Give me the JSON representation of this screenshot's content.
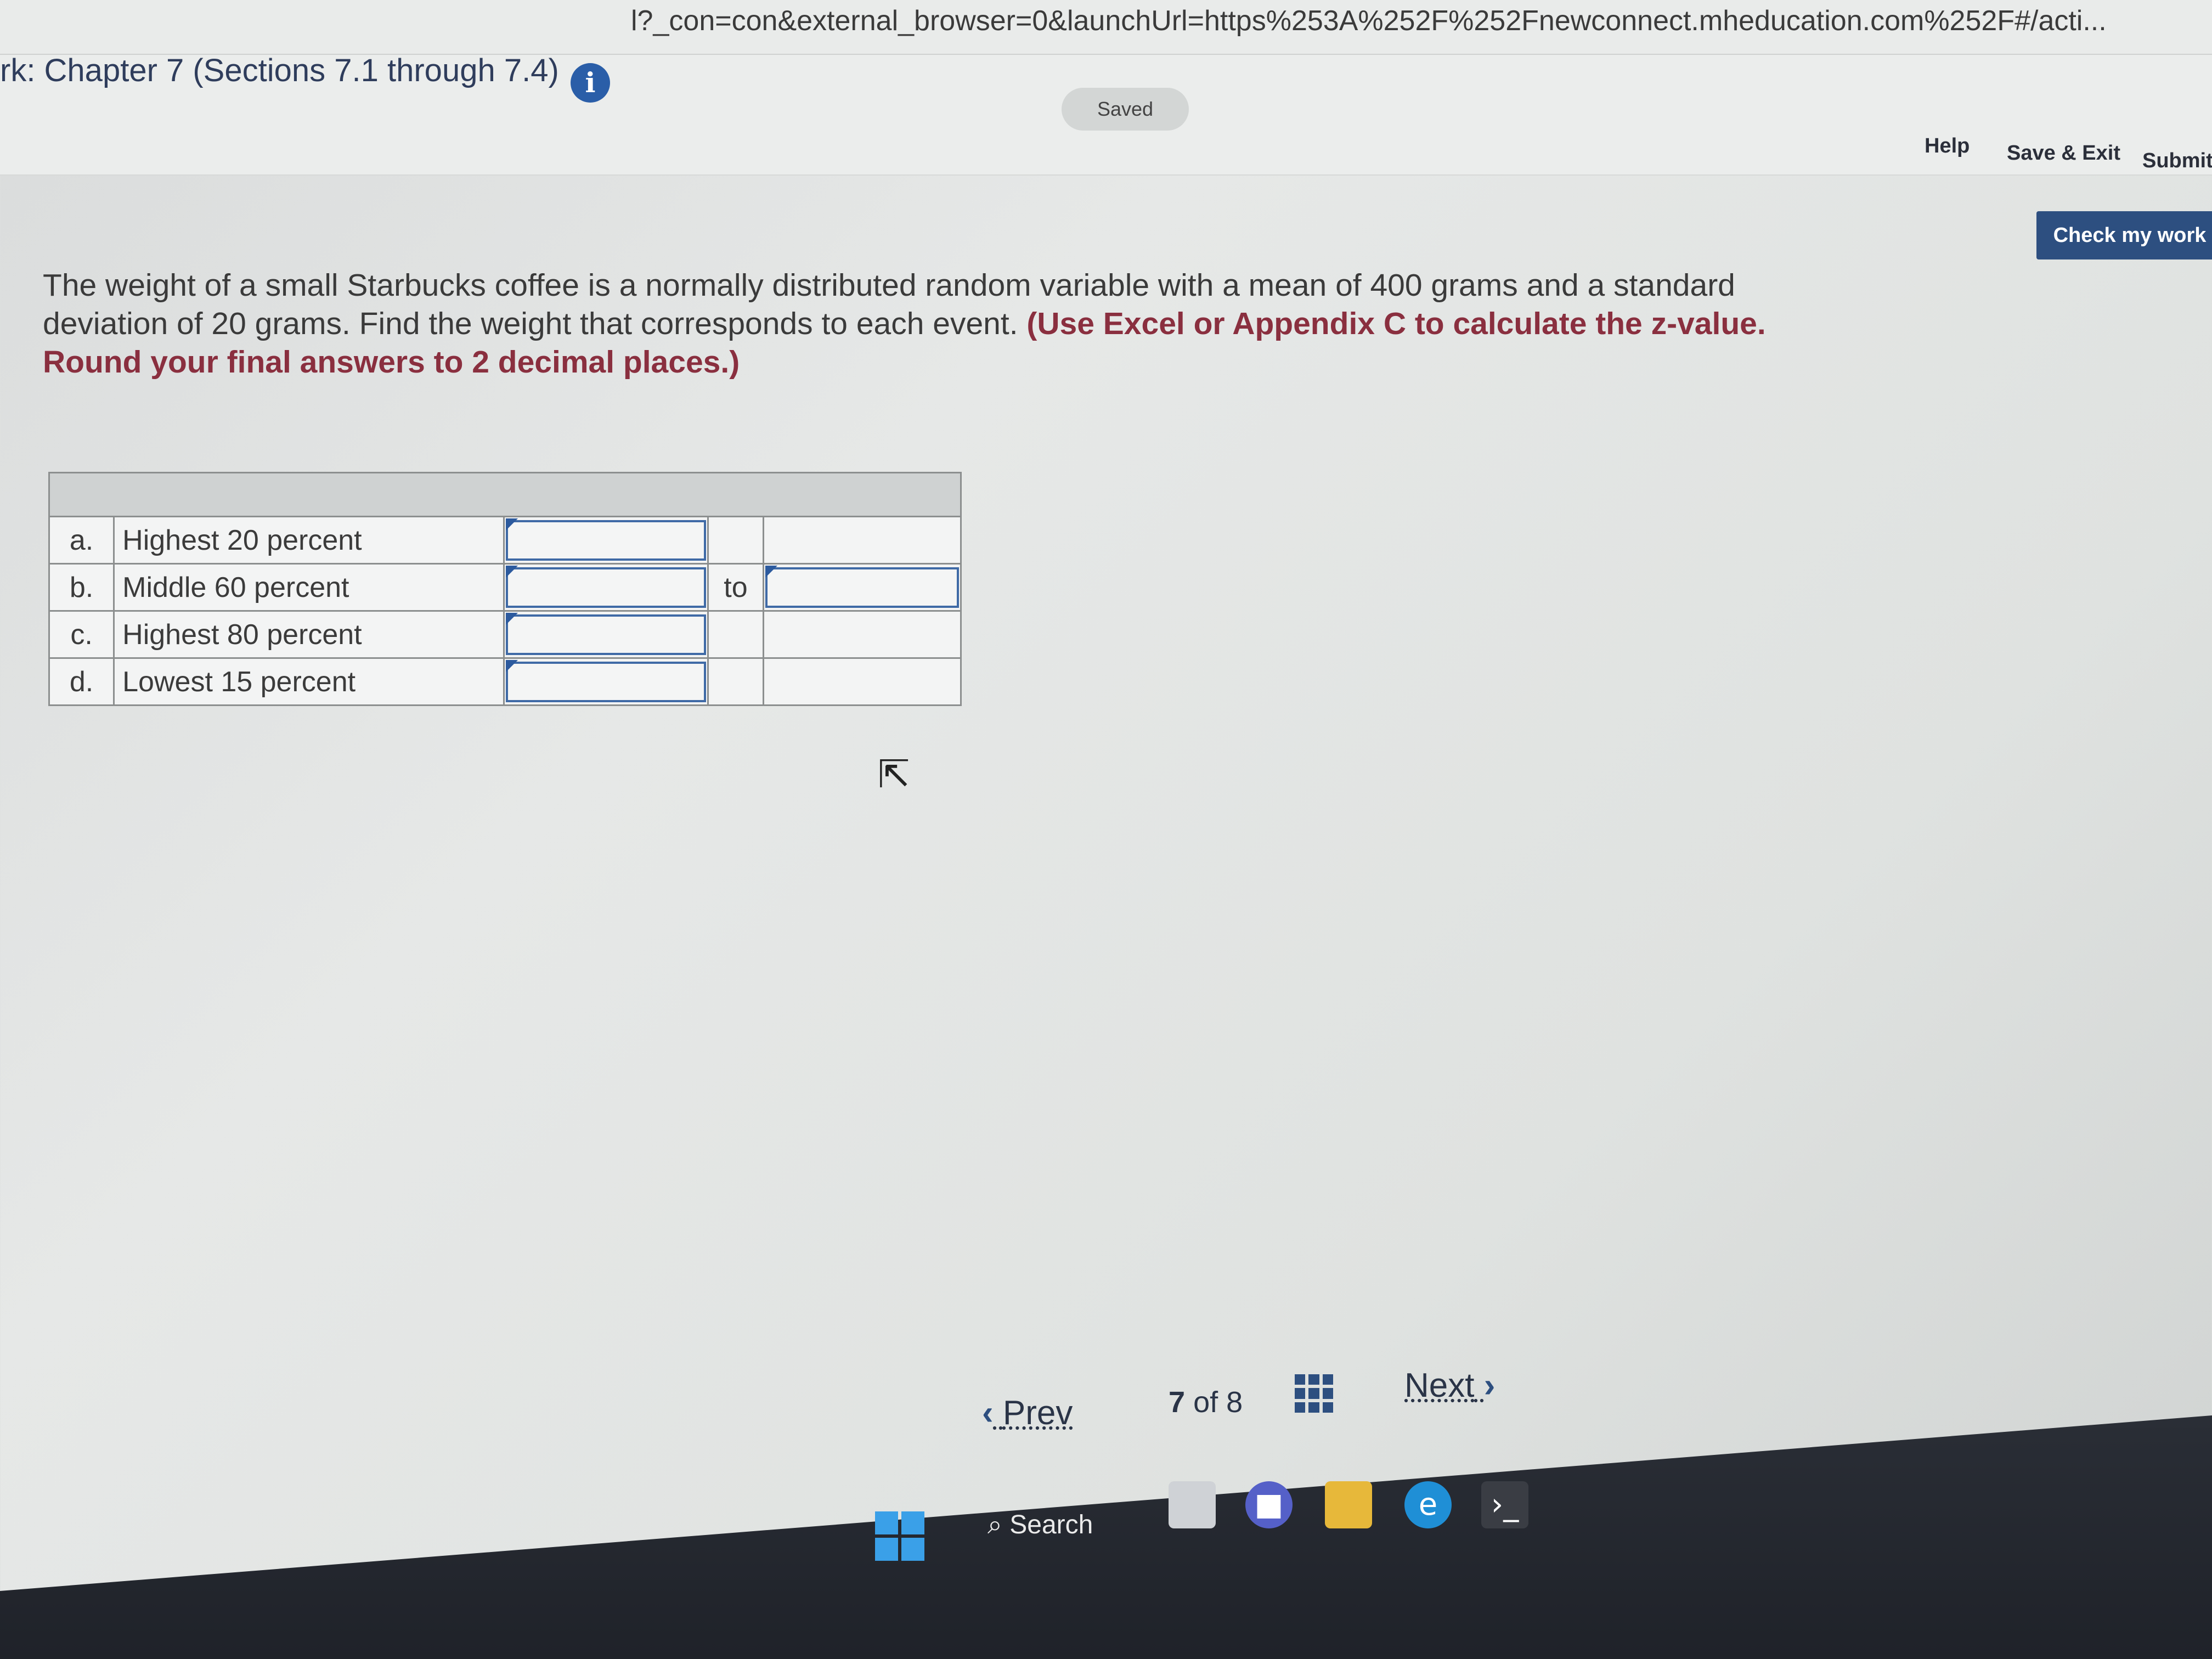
{
  "browser": {
    "url": "l?_con=con&external_browser=0&launchUrl=https%253A%252F%252Fnewconnect.mheducation.com%252F#/acti..."
  },
  "header": {
    "title": "rk: Chapter 7 (Sections 7.1 through 7.4)",
    "saved_label": "Saved",
    "help_label": "Help",
    "save_exit_label": "Save & Exit",
    "submit_label": "Submit",
    "check_label": "Check my work"
  },
  "question": {
    "text": "The weight of a small Starbucks coffee is a normally distributed random variable with a mean of 400 grams and a standard deviation of 20 grams. Find the weight that corresponds to each event.",
    "instruction": "(Use Excel or Appendix C to calculate the z-value. Round your final answers to 2 decimal places.)"
  },
  "table": {
    "rows": [
      {
        "letter": "a.",
        "label": "Highest 20 percent",
        "value": "",
        "to": "",
        "value2": ""
      },
      {
        "letter": "b.",
        "label": "Middle 60 percent",
        "value": "",
        "to": "to",
        "value2": ""
      },
      {
        "letter": "c.",
        "label": "Highest 80 percent",
        "value": "",
        "to": "",
        "value2": ""
      },
      {
        "letter": "d.",
        "label": "Lowest 15 percent",
        "value": "",
        "to": "",
        "value2": ""
      }
    ]
  },
  "navigation": {
    "prev_label": "Prev",
    "current": "7",
    "of_label": "of",
    "total": "8",
    "next_label": "Next"
  },
  "taskbar": {
    "search_label": "Search"
  },
  "colors": {
    "accent": "#2d4f80",
    "instruction": "#8a2f3f",
    "input_border": "#3f6aa6"
  }
}
